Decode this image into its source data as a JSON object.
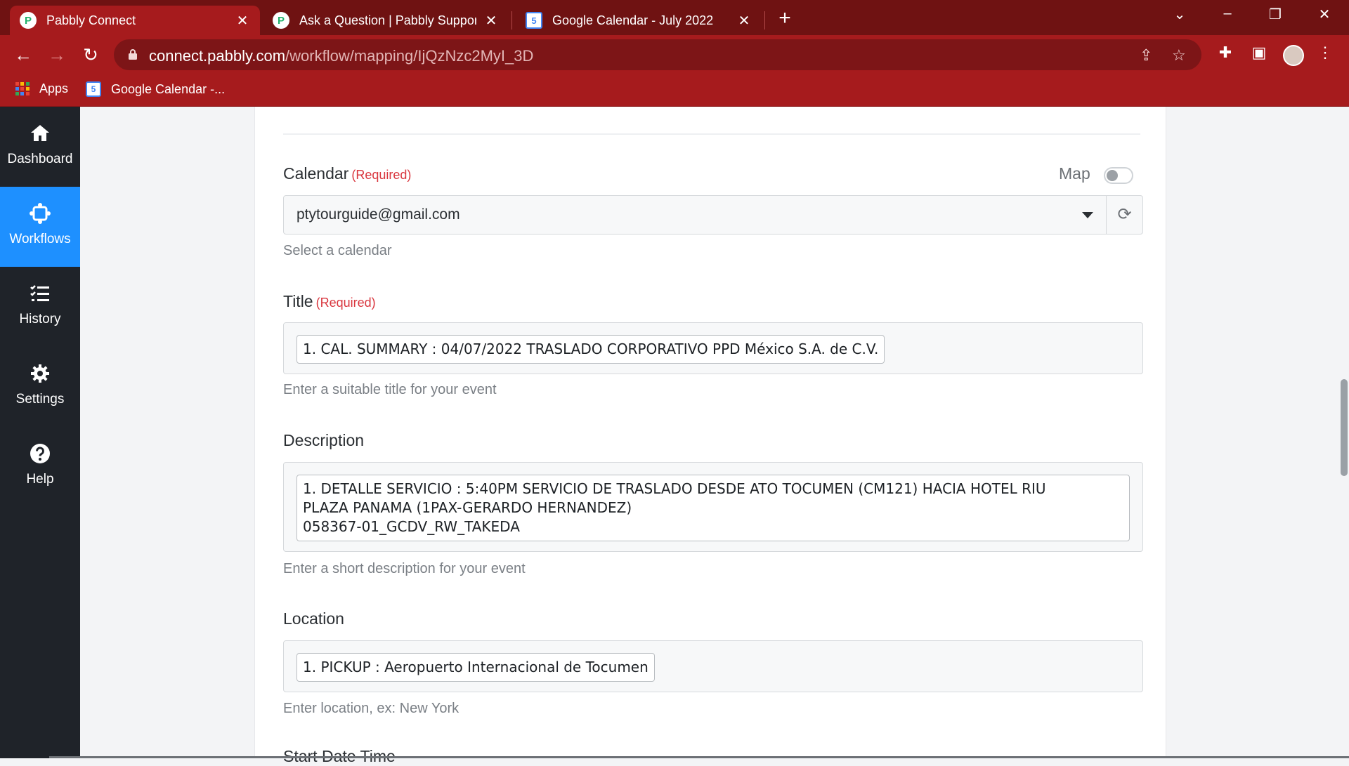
{
  "browser": {
    "tabs": [
      {
        "title": "Pabbly Connect",
        "favicon": "pabbly-icon",
        "active": true
      },
      {
        "title": "Ask a Question | Pabbly Support",
        "favicon": "pabbly-icon",
        "active": false
      },
      {
        "title": "Google Calendar - July 2022",
        "favicon": "google-calendar-icon",
        "active": false
      }
    ],
    "url_host": "connect.pabbly.com",
    "url_path": "/workflow/mapping/IjQzNzc2MyI_3D",
    "bookmarks": [
      {
        "label": "Apps",
        "icon": "apps-grid-icon"
      },
      {
        "label": "Google Calendar -...",
        "icon": "google-calendar-icon"
      }
    ],
    "calendar_favicon_text": "5",
    "pabbly_favicon_text": "P"
  },
  "sidebar": {
    "items": [
      {
        "label": "Dashboard",
        "icon": "home-icon"
      },
      {
        "label": "Workflows",
        "icon": "workflows-icon",
        "active": true
      },
      {
        "label": "History",
        "icon": "history-list-icon"
      },
      {
        "label": "Settings",
        "icon": "gear-icon"
      },
      {
        "label": "Help",
        "icon": "help-icon"
      }
    ]
  },
  "form": {
    "calendar": {
      "label": "Calendar",
      "required": "(Required)",
      "map_label": "Map",
      "value": "ptytourguide@gmail.com",
      "hint": "Select a calendar"
    },
    "title": {
      "label": "Title",
      "required": "(Required)",
      "value": "1. CAL. SUMMARY : 04/07/2022 TRASLADO CORPORATIVO PPD México S.A. de C.V.",
      "hint": "Enter a suitable title for your event"
    },
    "description": {
      "label": "Description",
      "value": "1. DETALLE SERVICIO : 5:40PM SERVICIO DE TRASLADO DESDE ATO TOCUMEN (CM121) HACIA HOTEL RIU\nPLAZA PANAMA (1PAX-GERARDO HERNANDEZ)\n058367-01_GCDV_RW_TAKEDA",
      "hint": "Enter a short description for your event"
    },
    "location": {
      "label": "Location",
      "value": "1. PICKUP : Aeropuerto Internacional de Tocumen",
      "hint": "Enter location, ex: New York"
    },
    "next_label_partial": "Start Date Time"
  },
  "colors": {
    "brand_red": "#a61b1d",
    "tabbar_dark": "#6f1212",
    "sidebar_bg": "#1f2329",
    "sidebar_active": "#1e90ff",
    "required_red": "#d9363e"
  }
}
